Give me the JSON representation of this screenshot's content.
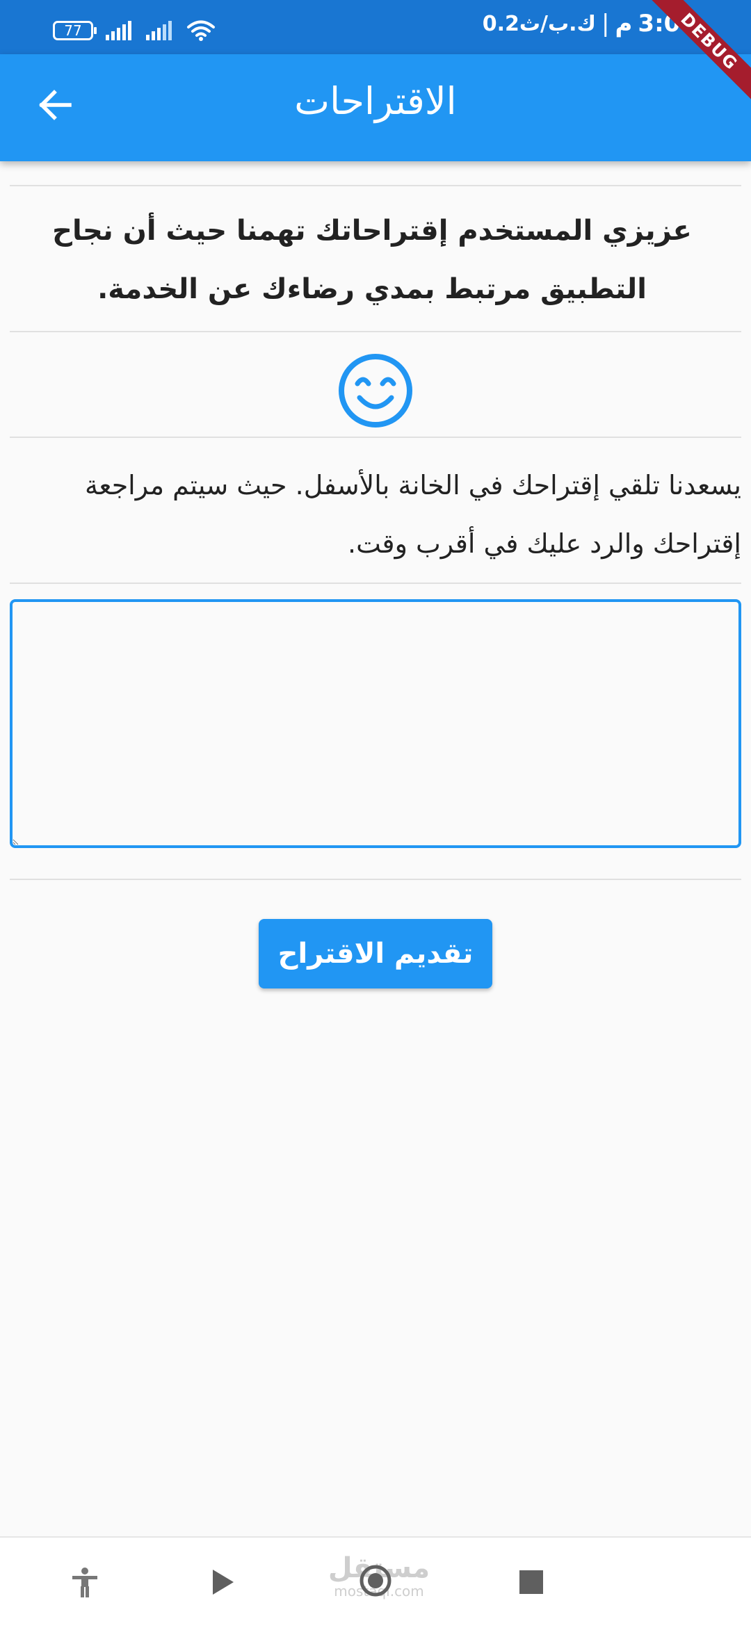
{
  "status_bar": {
    "time": "3:01",
    "am_pm": "م",
    "data_speed": "0.2ك.ب/ث",
    "battery_level": "77",
    "debug_label": "DEBUG"
  },
  "app_bar": {
    "title": "الاقتراحات",
    "back_icon": "arrow-back-icon"
  },
  "content": {
    "intro_text": "عزيزي المستخدم إقتراحاتك تهمنا حيث أن نجاح التطبيق مرتبط بمدي رضاءك عن الخدمة.",
    "emoji_icon": "smiling-face-icon",
    "info_text": "يسعدنا تلقي إقتراحك في الخانة بالأسفل. حيث سيتم مراجعة إقتراحك والرد عليك في أقرب وقت.",
    "input_value": "",
    "input_placeholder": "",
    "submit_label": "تقديم الاقتراح"
  },
  "nav_bar": {
    "items": [
      "accessibility-icon",
      "play-icon",
      "home-circle-icon",
      "stop-square-icon"
    ],
    "watermark_ar": "مستقل",
    "watermark_en": "mostaql.com"
  },
  "colors": {
    "primary": "#2196f3",
    "status_bar": "#1976d2",
    "background": "#fafafa",
    "debug_ribbon": "#a51d2d"
  }
}
